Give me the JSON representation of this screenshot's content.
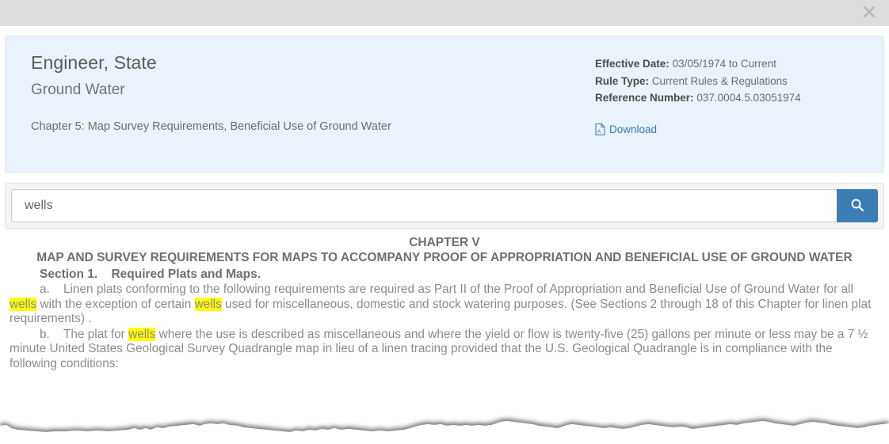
{
  "topbar": {
    "close_label": "✕",
    "close_icon": "close-icon"
  },
  "header": {
    "title": "Engineer, State",
    "subtitle": "Ground Water",
    "chapter": "Chapter 5: Map Survey Requirements, Beneficial Use of Ground Water",
    "meta": [
      {
        "label": "Effective Date:",
        "value": "03/05/1974 to Current"
      },
      {
        "label": "Rule Type:",
        "value": "Current Rules & Regulations"
      },
      {
        "label": "Reference Number:",
        "value": "037.0004.5.03051974"
      }
    ],
    "download_label": "Download",
    "download_icon": "pdf-file-icon",
    "accent_color": "#337ab7",
    "card_background": "#eaf3fb"
  },
  "search": {
    "value": "wells",
    "placeholder": "",
    "button_icon": "search-icon",
    "button_color": "#3c7db5"
  },
  "document": {
    "chapter_head": "CHAPTER V",
    "chapter_title": "MAP AND SURVEY REQUIREMENTS FOR MAPS TO ACCOMPANY PROOF OF APPROPRIATION AND BENEFICIAL USE OF GROUND WATER",
    "section_head": "Section 1.    Required Plats and Maps.",
    "highlight_color": "#ffff00",
    "highlight_term": "wells",
    "paragraph_a": {
      "marker": "a.",
      "segments": [
        {
          "text": "Linen plats conforming to the following requirements are required as Part II of the Proof of Appropriation and Beneficial Use of Ground Water for all ",
          "highlight": false
        },
        {
          "text": "wells",
          "highlight": true
        },
        {
          "text": " with the exception of certain ",
          "highlight": false
        },
        {
          "text": "wells",
          "highlight": true
        },
        {
          "text": " used for miscellaneous, domestic and stock watering purposes. (See Sections 2 through 18 of this Chapter for linen plat requirements)   .",
          "highlight": false
        }
      ]
    },
    "paragraph_b": {
      "marker": "b.",
      "segments": [
        {
          "text": "The plat for ",
          "highlight": false
        },
        {
          "text": "wells",
          "highlight": true
        },
        {
          "text": " where the use is described as miscellaneous and where the yield or flow is twenty-five (25) gallons per minute or less may be a 7 ½ minute United States Geological Survey Quadrangle map in lieu of a linen tracing provided that the U.S. Geological Quadrangle is in compliance with the following conditions:",
          "highlight": false
        }
      ]
    }
  }
}
